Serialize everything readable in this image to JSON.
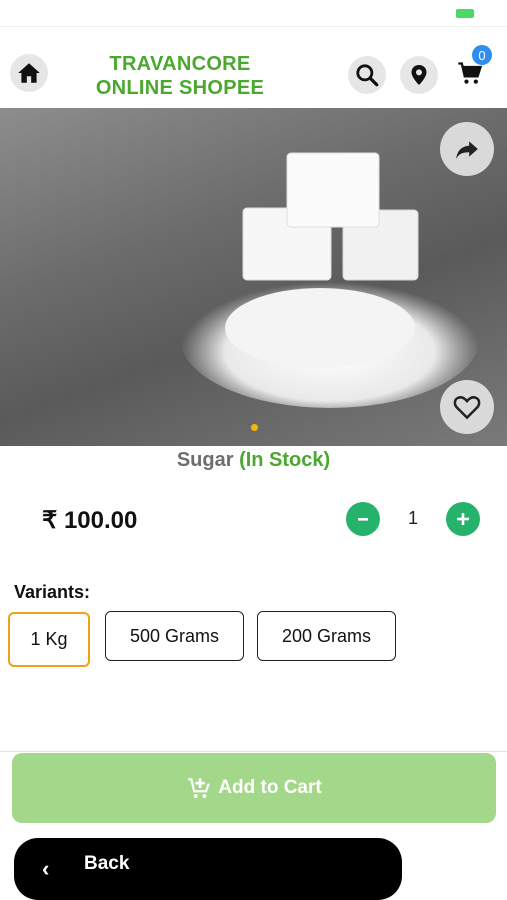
{
  "header": {
    "brand_line1": "TRAVANCORE",
    "brand_line2": "ONLINE SHOPEE",
    "cart_count": "0",
    "icons": [
      "home-icon",
      "search-icon",
      "location-pin-icon",
      "cart-icon"
    ]
  },
  "product": {
    "name": "Sugar",
    "stock_status": "(In Stock)",
    "price": "₹ 100.00",
    "quantity": "1",
    "image_indicator_count": 1,
    "image_active_index": 0
  },
  "variants": {
    "label": "Variants:",
    "options": [
      "1 Kg",
      "500 Grams",
      "200 Grams"
    ],
    "selected": "1 Kg"
  },
  "actions": {
    "add_to_cart": "Add to Cart",
    "back": "Back"
  },
  "colors": {
    "brand_green": "#4aa82f",
    "qty_button": "#25b36b",
    "add_to_cart_bg": "#a3d88a",
    "selected_variant_border": "#f0a11a",
    "cart_badge": "#2f8cf0"
  }
}
